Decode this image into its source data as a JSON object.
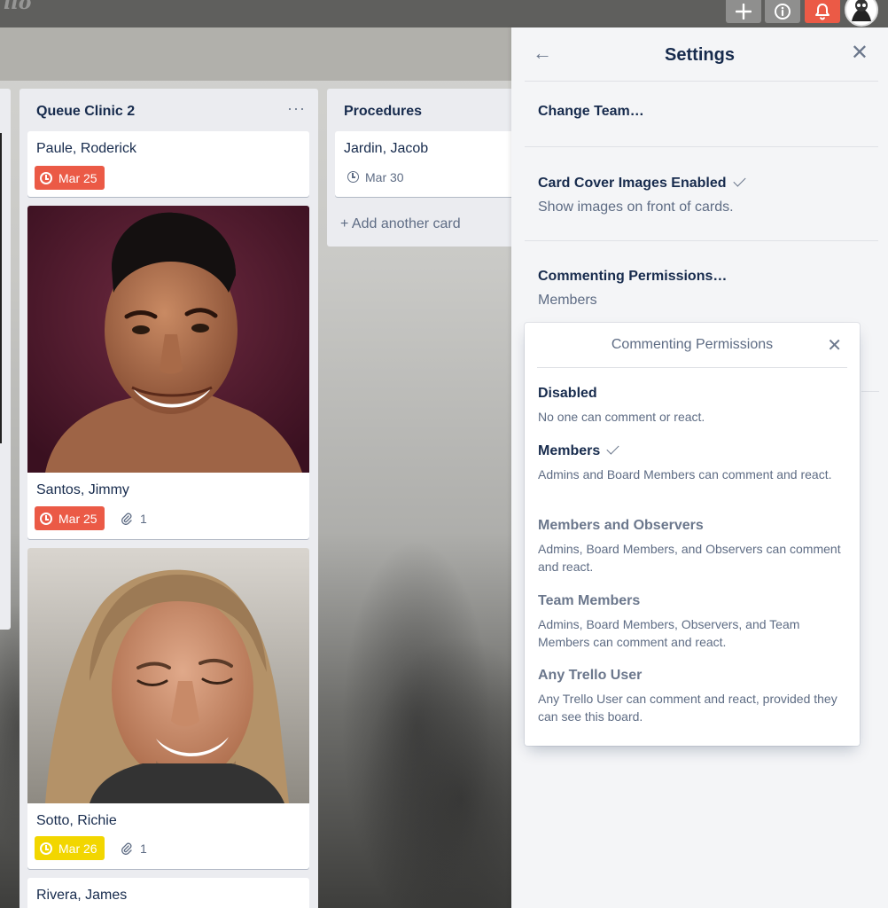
{
  "topbar": {
    "logo": "llo",
    "add_icon": "plus-icon",
    "info_icon": "info-icon",
    "bell_icon": "bell-icon",
    "colors": {
      "bell": "#eb5a46"
    }
  },
  "lists": [
    {
      "title": "Queue Clinic 2",
      "menu": "···",
      "cards": [
        {
          "name": "Paule, Roderick",
          "due": "Mar 25",
          "due_color": "#eb5a46"
        },
        {
          "name": "Santos, Jimmy",
          "due": "Mar 25",
          "due_color": "#eb5a46",
          "attachments": "1"
        },
        {
          "name": "Sotto, Richie",
          "due": "Mar 26",
          "due_color": "#f2d600",
          "attachments": "1"
        },
        {
          "name": "Rivera, James"
        }
      ]
    },
    {
      "title": "Procedures",
      "cards": [
        {
          "name": "Jardin, Jacob",
          "due": "Mar 30"
        }
      ],
      "add_card": "+ Add another card"
    }
  ],
  "settings": {
    "title": "Settings",
    "change_team": "Change Team…",
    "card_cover_title": "Card Cover Images Enabled",
    "card_cover_desc": "Show images on front of cards.",
    "commenting_title": "Commenting Permissions…",
    "commenting_value": "Members"
  },
  "popover": {
    "title": "Commenting Permissions",
    "options": [
      {
        "title": "Disabled",
        "desc": "No one can comment or react."
      },
      {
        "title": "Members",
        "desc": "Admins and Board Members can comment and react.",
        "selected": true
      },
      {
        "title": "Members and Observers",
        "desc": "Admins, Board Members, and Observers can comment and react."
      },
      {
        "title": "Team Members",
        "desc": "Admins, Board Members, Observers, and Team Members can comment and react."
      },
      {
        "title": "Any Trello User",
        "desc": "Any Trello User can comment and react, provided they can see this board."
      }
    ]
  }
}
